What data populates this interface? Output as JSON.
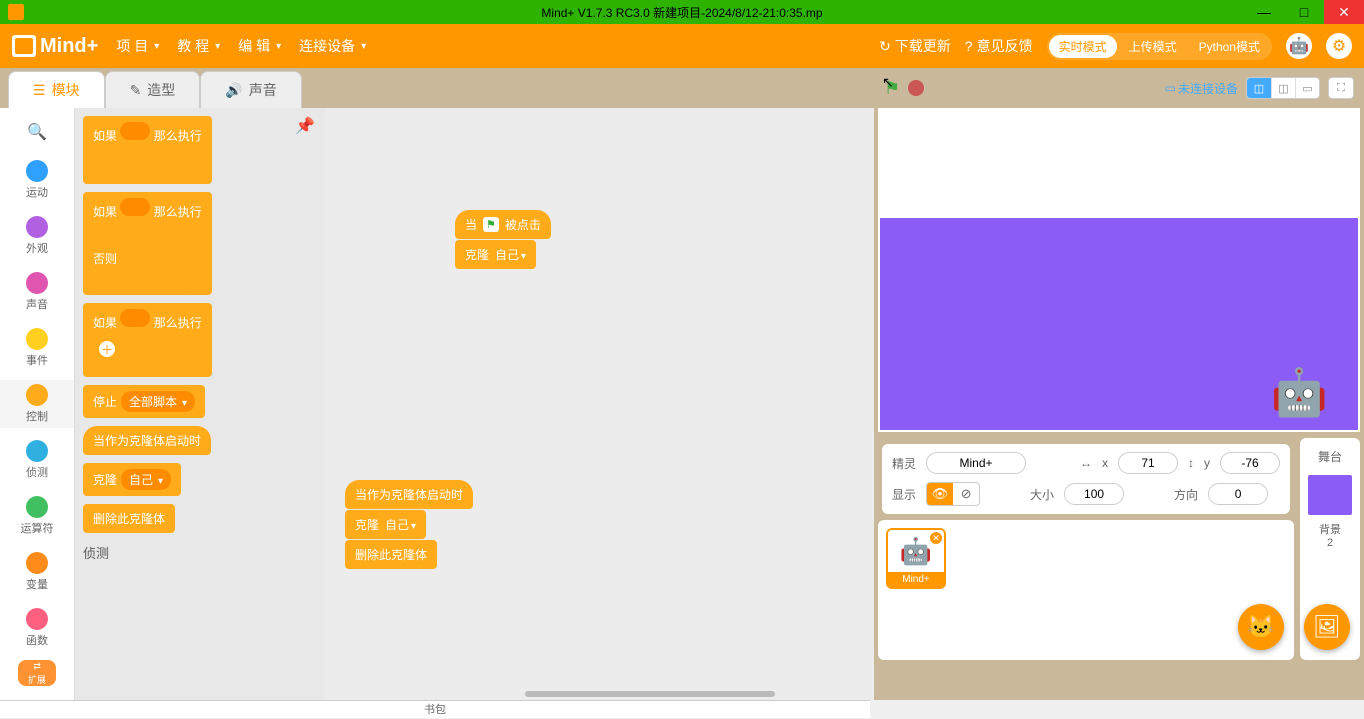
{
  "titlebar": {
    "title": "Mind+ V1.7.3 RC3.0   新建项目-2024/8/12-21:0:35.mp"
  },
  "menu": {
    "logo": "Mind+",
    "items": [
      "项 目",
      "教 程",
      "编 辑",
      "连接设备"
    ],
    "download": "下载更新",
    "feedback": "意见反馈",
    "modes": {
      "realtime": "实时模式",
      "upload": "上传模式",
      "python": "Python模式"
    }
  },
  "tabs": {
    "blocks": "模块",
    "costumes": "造型",
    "sounds": "声音"
  },
  "categories": [
    {
      "label": "运动",
      "color": "#30a0ff"
    },
    {
      "label": "外观",
      "color": "#b060e0"
    },
    {
      "label": "声音",
      "color": "#e055b0"
    },
    {
      "label": "事件",
      "color": "#ffd020"
    },
    {
      "label": "控制",
      "color": "#ffab1a"
    },
    {
      "label": "侦测",
      "color": "#30b0e0"
    },
    {
      "label": "运算符",
      "color": "#40c060"
    },
    {
      "label": "变量",
      "color": "#ff8c1a"
    },
    {
      "label": "函数",
      "color": "#ff6080"
    }
  ],
  "ext_label": "扩展",
  "palette": {
    "if_then": "如果",
    "then_exec": "那么执行",
    "else": "否则",
    "plus": "＋",
    "stop": "停止",
    "stop_opt": "全部脚本",
    "when_clone": "当作为克隆体启动时",
    "clone": "克隆",
    "clone_opt": "自己",
    "delete_clone": "删除此克隆体",
    "sensing_heading": "侦测"
  },
  "script": {
    "when_flag": "当",
    "clicked": "被点击",
    "clone": "克隆",
    "clone_opt": "自己",
    "when_clone": "当作为克隆体启动时",
    "delete_clone": "删除此克隆体"
  },
  "stage_header": {
    "device": "未连接设备"
  },
  "sprite_info": {
    "sprite_label": "精灵",
    "sprite_name": "Mind+",
    "x_label": "x",
    "x_val": "71",
    "y_label": "y",
    "y_val": "-76",
    "show_label": "显示",
    "size_label": "大小",
    "size_val": "100",
    "dir_label": "方向",
    "dir_val": "0"
  },
  "sprite_card": {
    "name": "Mind+"
  },
  "stage_panel": {
    "label": "舞台",
    "bg_label": "背景",
    "bg_count": "2"
  },
  "backpack": "书包"
}
